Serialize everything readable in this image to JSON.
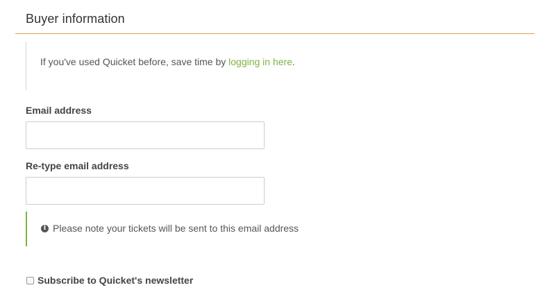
{
  "section": {
    "title": "Buyer information"
  },
  "login_note": {
    "text_before": "If you've used Quicket before, save time by ",
    "link_text": "logging in here",
    "text_after": "."
  },
  "email_field": {
    "label": "Email address",
    "value": "",
    "placeholder": ""
  },
  "retype_email_field": {
    "label": "Re-type email address",
    "value": "",
    "placeholder": ""
  },
  "email_note": {
    "icon": "info-circle-icon",
    "text": "Please note your tickets will be sent to this email address"
  },
  "newsletter": {
    "label": "Subscribe to Quicket's newsletter",
    "checked": false
  },
  "colors": {
    "rule": "#d9a441",
    "link": "#7cb342",
    "note_border": "#7cb342"
  }
}
